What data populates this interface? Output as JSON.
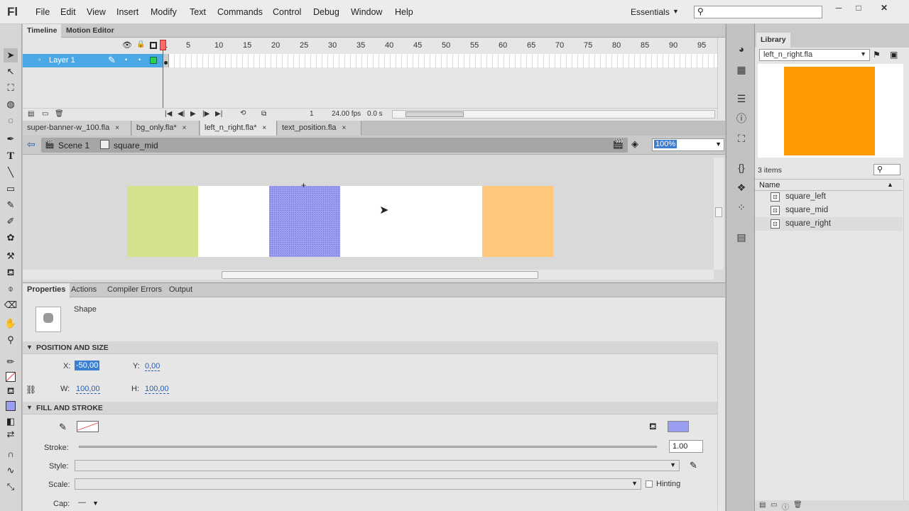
{
  "app": {
    "logo": "Fl"
  },
  "menu": [
    "File",
    "Edit",
    "View",
    "Insert",
    "Modify",
    "Text",
    "Commands",
    "Control",
    "Debug",
    "Window",
    "Help"
  ],
  "workspace": "Essentials",
  "window_controls": {
    "minimize": "─",
    "maximize": "□",
    "close": "✕"
  },
  "timeline": {
    "tabs": [
      "Timeline",
      "Motion Editor"
    ],
    "layer": "Layer 1",
    "frame_numbers": [
      "1",
      "5",
      "10",
      "15",
      "20",
      "25",
      "30",
      "35",
      "40",
      "45",
      "50",
      "55",
      "60",
      "65",
      "70",
      "75",
      "80",
      "85",
      "90",
      "95"
    ],
    "current_frame": "1",
    "fps": "24.00 fps",
    "time": "0.0 s"
  },
  "doc_tabs": [
    {
      "label": "super-banner-w_100.fla",
      "close": "×",
      "active": false
    },
    {
      "label": "bg_only.fla*",
      "close": "×",
      "active": false
    },
    {
      "label": "left_n_right.fla*",
      "close": "×",
      "active": true
    },
    {
      "label": "text_position.fla",
      "close": "×",
      "active": false
    }
  ],
  "editbar": {
    "scene": "Scene 1",
    "symbol": "square_mid",
    "zoom": "100%"
  },
  "stage": {
    "squares": [
      {
        "name": "square_left",
        "color": "#d3e38c"
      },
      {
        "name": "square_mid",
        "color": "#9a9ef0"
      },
      {
        "name": "square_right",
        "color": "#ffc87c"
      }
    ]
  },
  "properties": {
    "tabs": [
      "Properties",
      "Actions",
      "Compiler Errors",
      "Output"
    ],
    "instance_type": "Shape",
    "position_size_title": "POSITION AND SIZE",
    "x_label": "X:",
    "x": "-50,00",
    "y_label": "Y:",
    "y": "0,00",
    "w_label": "W:",
    "w": "100,00",
    "h_label": "H:",
    "h": "100,00",
    "fill_stroke_title": "FILL AND STROKE",
    "fill_color": "#9a9ef0",
    "stroke_label": "Stroke:",
    "stroke_value": "1.00",
    "style_label": "Style:",
    "scale_label": "Scale:",
    "hinting_label": "Hinting",
    "cap_label": "Cap:",
    "cap_value": "—"
  },
  "library": {
    "tab": "Library",
    "file": "left_n_right.fla",
    "preview_color": "#ff9a00",
    "count": "3 items",
    "name_header": "Name",
    "items": [
      "square_left",
      "square_mid",
      "square_right"
    ]
  }
}
